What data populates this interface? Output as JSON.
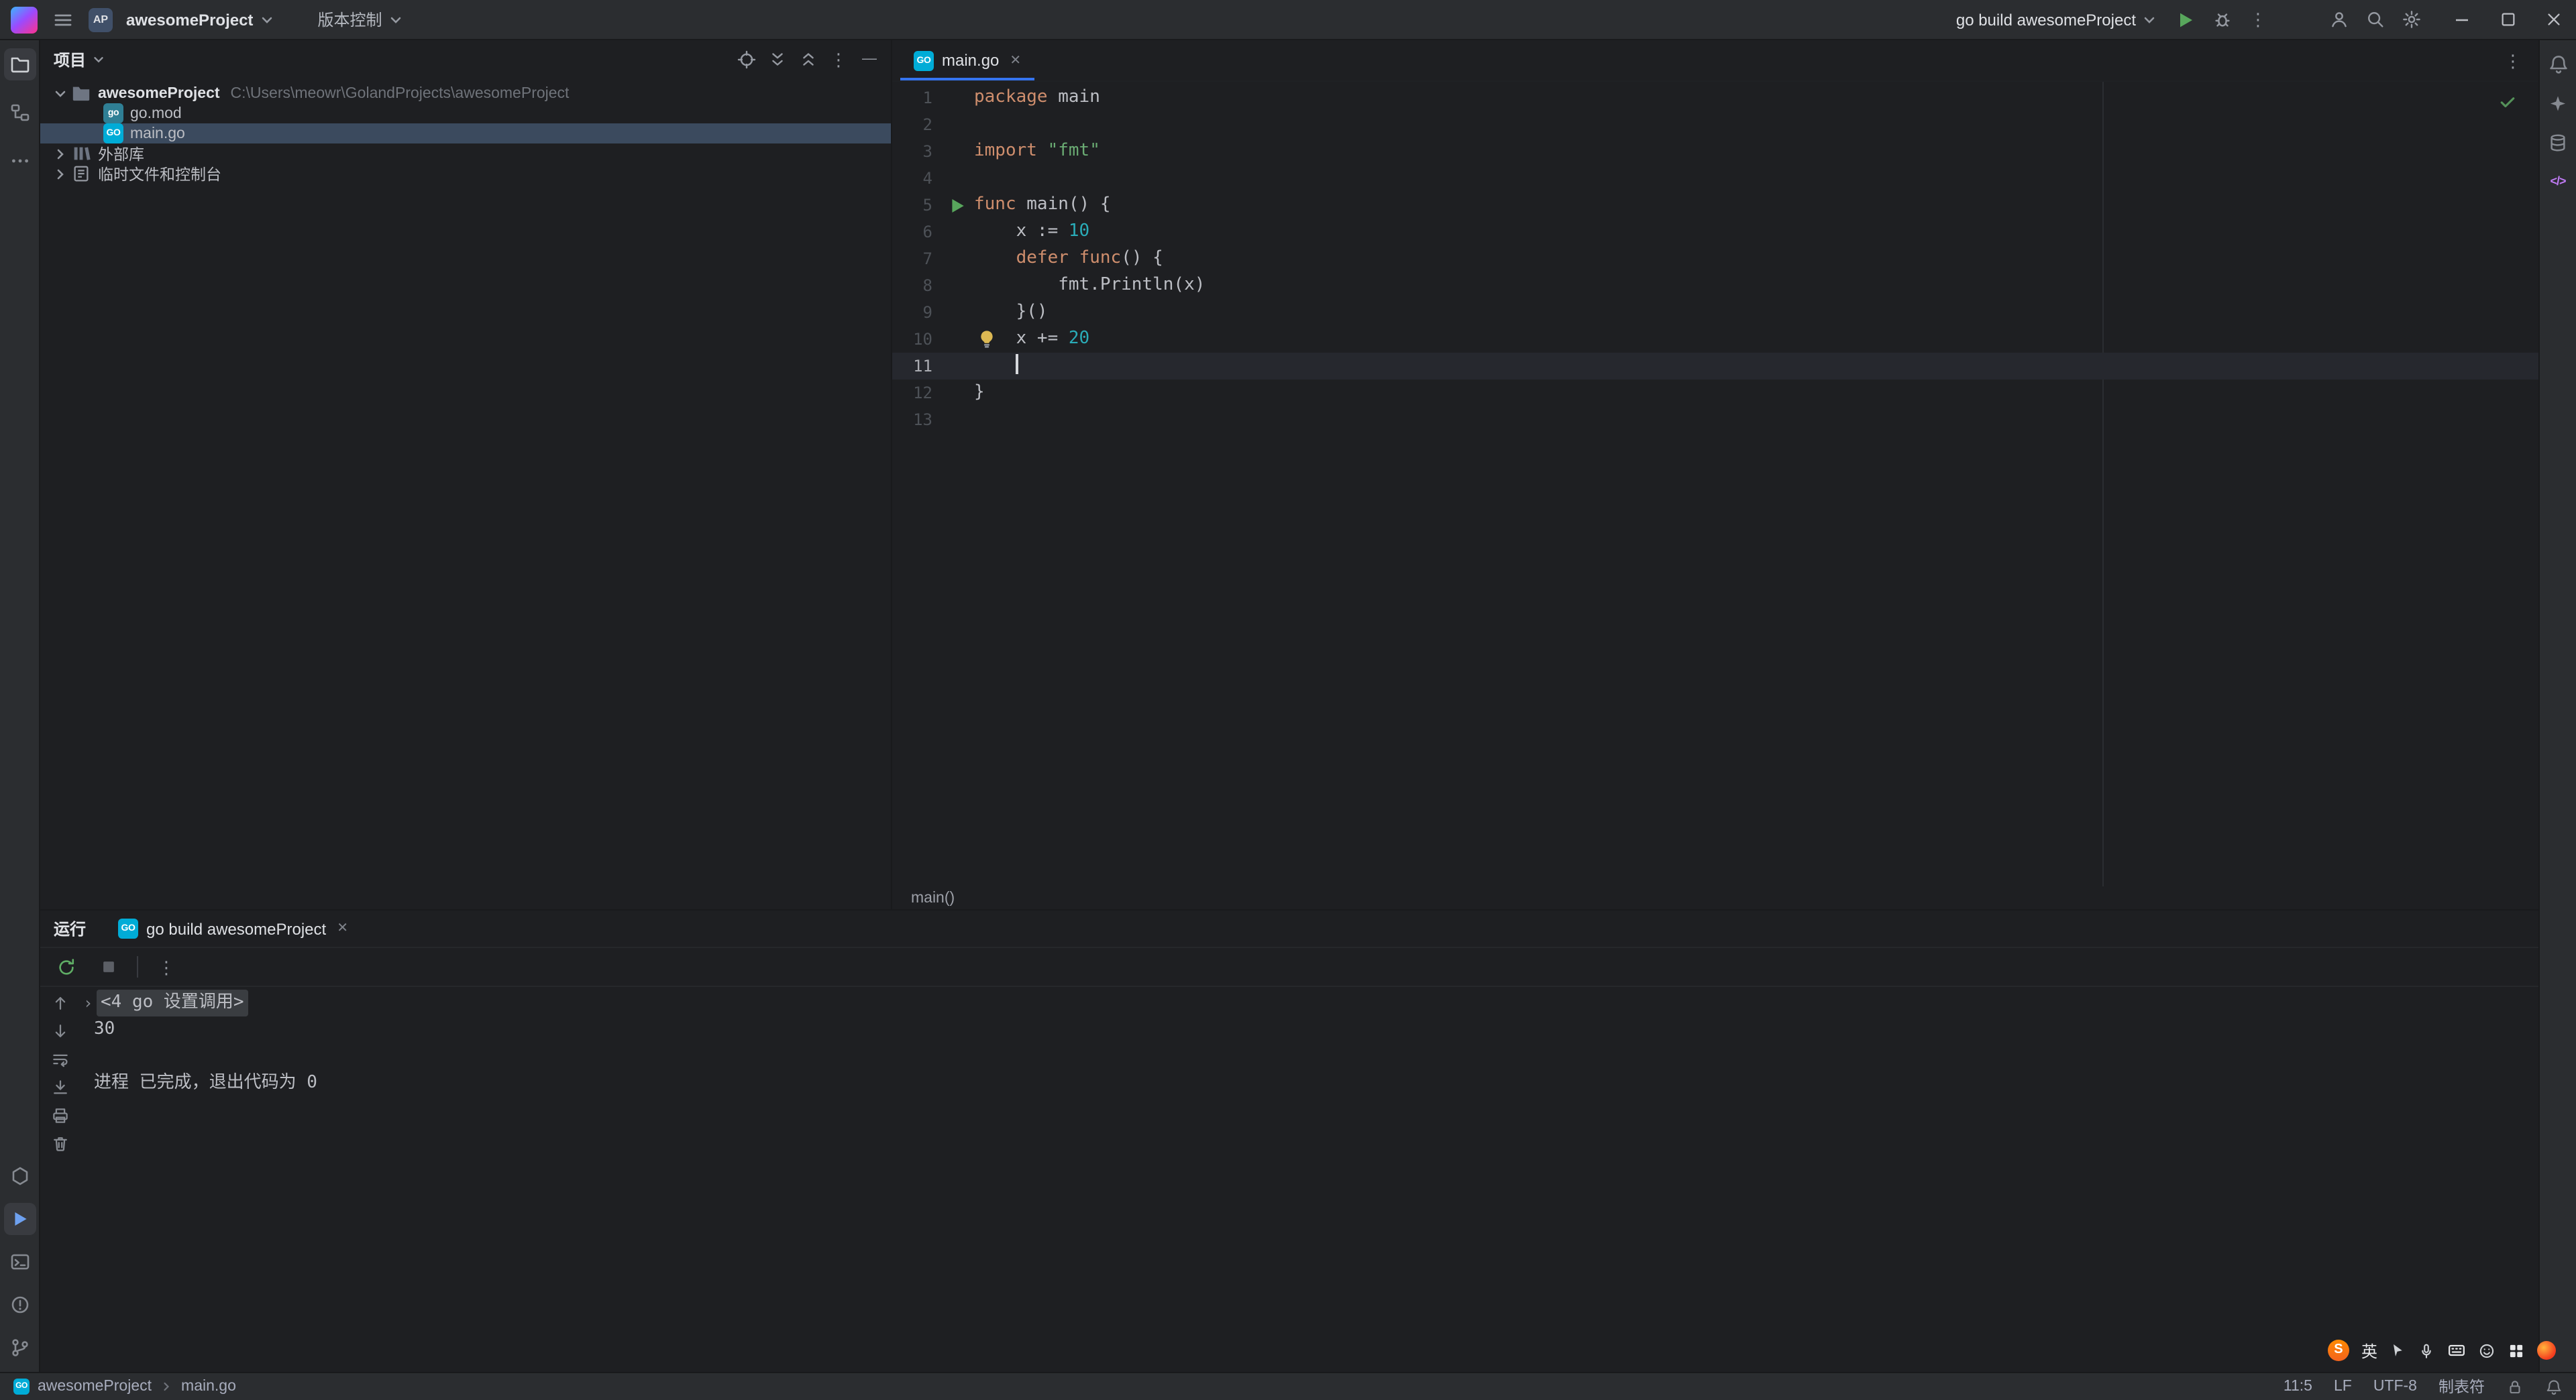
{
  "titlebar": {
    "project_initials": "AP",
    "project_name": "awesomeProject",
    "vcs_label": "版本控制",
    "run_config": "go build awesomeProject"
  },
  "left_strip": {
    "top_icons": [
      "project",
      "structure",
      "more"
    ],
    "bottom_icons": [
      "services",
      "run",
      "terminal",
      "problems",
      "version-control"
    ]
  },
  "right_strip_icons": [
    "notifications",
    "ai-assistant",
    "database",
    "code-tags"
  ],
  "project_panel": {
    "title": "项目",
    "tree": [
      {
        "label": "awesomeProject",
        "path": "C:\\Users\\meowr\\GolandProjects\\awesomeProject",
        "level": 0,
        "expanded": true,
        "icon": "folder",
        "selected": false
      },
      {
        "label": "go.mod",
        "level": 1,
        "icon": "go-mod",
        "selected": false
      },
      {
        "label": "main.go",
        "level": 1,
        "icon": "go-file",
        "selected": true
      },
      {
        "label": "外部库",
        "level": 0,
        "expanded": false,
        "icon": "library",
        "selected": false
      },
      {
        "label": "临时文件和控制台",
        "level": 0,
        "expanded": false,
        "icon": "scratch",
        "selected": false
      }
    ]
  },
  "editor": {
    "tab": {
      "label": "main.go"
    },
    "breadcrumb": "main()",
    "run_line": 5,
    "bulb_line": 10,
    "cursor": {
      "line": 11,
      "col": 5
    },
    "lines": [
      [
        [
          "kw",
          "package"
        ],
        [
          "pl",
          " main"
        ]
      ],
      [],
      [
        [
          "kw",
          "import"
        ],
        [
          "pl",
          " "
        ],
        [
          "str",
          "\"fmt\""
        ]
      ],
      [],
      [
        [
          "kw",
          "func"
        ],
        [
          "pl",
          " main() {"
        ]
      ],
      [
        [
          "pl",
          "    x := "
        ],
        [
          "num",
          "10"
        ]
      ],
      [
        [
          "pl",
          "    "
        ],
        [
          "kw",
          "defer"
        ],
        [
          "pl",
          " "
        ],
        [
          "kw",
          "func"
        ],
        [
          "pl",
          "() {"
        ]
      ],
      [
        [
          "pl",
          "        fmt.Println(x)"
        ]
      ],
      [
        [
          "pl",
          "    }()"
        ]
      ],
      [
        [
          "pl",
          "    x += "
        ],
        [
          "num",
          "20"
        ]
      ],
      [
        [
          "pl",
          "    "
        ]
      ],
      [
        [
          "pl",
          "}"
        ]
      ],
      []
    ]
  },
  "run_panel": {
    "title": "运行",
    "tab": {
      "label": "go build awesomeProject"
    },
    "console": [
      {
        "fold": true,
        "text": "<4 go 设置调用>"
      },
      {
        "text": "30"
      },
      {
        "text": ""
      },
      {
        "text": "进程 已完成，退出代码为 0"
      }
    ]
  },
  "statusbar": {
    "project": "awesomeProject",
    "file": "main.go",
    "caret": "11:5",
    "line_separator": "LF",
    "encoding": "UTF-8",
    "indent": "制表符"
  },
  "ime": {
    "logo": "S",
    "mode": "英"
  },
  "glyphs": {
    "more_vertical": "⋮",
    "close": "✕",
    "hide": "—",
    "go_badge": "GO",
    "go_mod_badge": "go",
    "code_tags": "</>",
    "fold_arrow": "›"
  },
  "colors": {
    "accent": "#3574f0",
    "run_green": "#58a65c",
    "keyword": "#cf8e6d",
    "string": "#6aab73",
    "number": "#2aacb8",
    "editor_bg": "#1e1f22",
    "panel_bg": "#2b2d30",
    "selection": "#3b4a5e",
    "current_line": "#26282e",
    "fold_bg": "#3a3d41",
    "sogou_orange": "#f4631e"
  }
}
